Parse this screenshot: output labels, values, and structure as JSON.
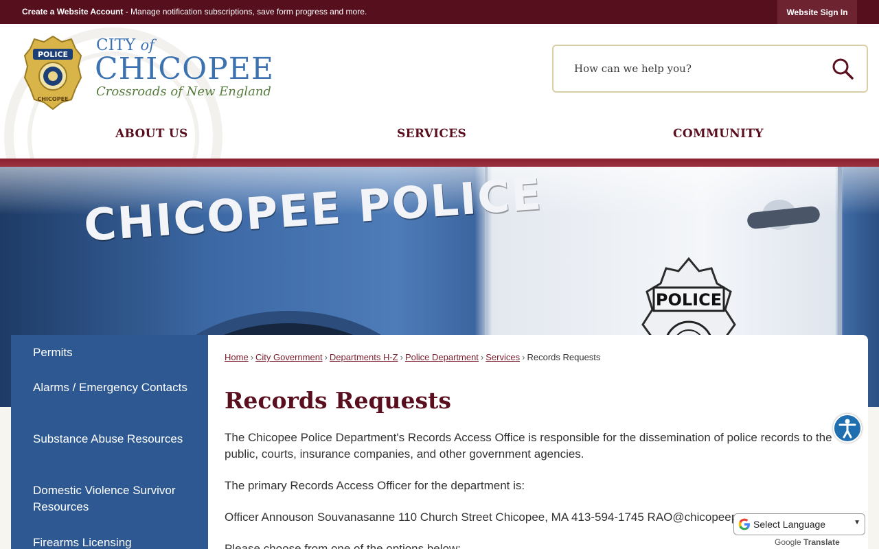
{
  "topbar": {
    "account_link": "Create a Website Account",
    "account_desc": " - Manage notification subscriptions, save form progress and more.",
    "signin": "Website Sign In"
  },
  "logo": {
    "badge_top": "POLICE",
    "badge_bottom": "CHICOPEE",
    "city_of_1": "CITY",
    "city_of_2": "of",
    "name": "CHICOPEE",
    "tagline": "Crossroads of New England"
  },
  "search": {
    "placeholder": "How can we help you?"
  },
  "nav": [
    {
      "label": "ABOUT US"
    },
    {
      "label": "SERVICES"
    },
    {
      "label": "COMMUNITY"
    }
  ],
  "hero": {
    "car_text": "CHICOPEE POLICE",
    "door_badge": "POLICE"
  },
  "sidebar": {
    "items": [
      {
        "label": "Permits"
      },
      {
        "label": "Alarms / Emergency Contacts"
      },
      {
        "label": "Substance Abuse Resources"
      },
      {
        "label": "Domestic Violence Survivor Resources"
      },
      {
        "label": "Firearms Licensing"
      }
    ]
  },
  "breadcrumb": {
    "links": [
      "Home",
      "City Government",
      "Departments H-Z",
      "Police Department",
      "Services"
    ],
    "current": "Records Requests",
    "separator": "›"
  },
  "page": {
    "title": "Records Requests",
    "p1": "The Chicopee Police Department's Records Access Office is responsible for the dissemination of police records to the public, courts, insurance companies, and other government agencies.",
    "p2": "The primary Records Access Officer for the department is:",
    "p3": "Officer Annouson Souvanasanne  110 Church Street Chicopee, MA  413-594-1745    RAO@chicopeep...",
    "p4": "Please choose from one of the options below:"
  },
  "translate": {
    "label": "Select Language",
    "powered_by": "Google",
    "translate_word": "Translate"
  },
  "colors": {
    "maroon": "#560f1c",
    "nav_text": "#5a0f1e",
    "sidebar_blue": "#2d5891",
    "logo_blue": "#3d72b0",
    "logo_green": "#557b3c"
  }
}
